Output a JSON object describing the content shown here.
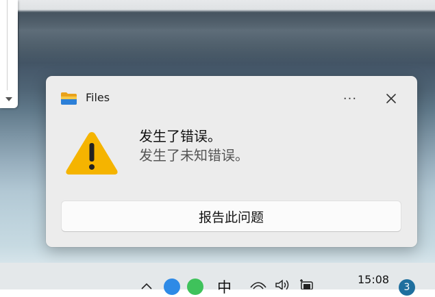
{
  "notification": {
    "app_name": "Files",
    "app_icon": "folder-icon",
    "more_label": "···",
    "close_icon": "close-icon",
    "status_icon": "warning-icon",
    "title": "发生了错误。",
    "body": "发生了未知错误。",
    "action_label": "报告此问题"
  },
  "taskbar": {
    "ime_label": "中",
    "clock_time": "15:08",
    "notification_count": "3",
    "tray_icons": [
      "chevron-up-icon",
      "app-icon-blue",
      "app-icon-green",
      "wifi-icon",
      "volume-icon",
      "battery-icon"
    ]
  },
  "colors": {
    "warning": "#f5b400",
    "toast_bg": "#ececec",
    "badge": "#1f6f9e"
  }
}
